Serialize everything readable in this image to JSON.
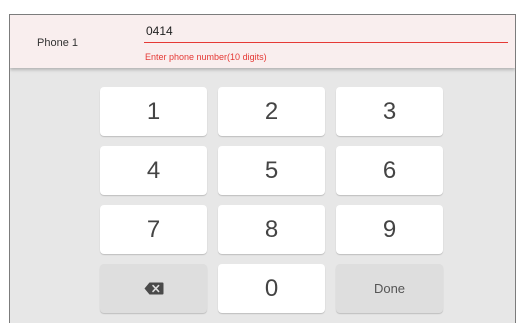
{
  "field": {
    "label": "Phone 1",
    "value": "0414",
    "error": "Enter phone number(10 digits)",
    "error_color": "#e53935"
  },
  "keypad": {
    "keys": [
      "1",
      "2",
      "3",
      "4",
      "5",
      "6",
      "7",
      "8",
      "9",
      "0"
    ],
    "backspace_icon": "backspace-icon",
    "done_label": "Done"
  },
  "colors": {
    "background": "#e7e7e7",
    "key": "#ffffff",
    "function_key": "#dedede",
    "field_background": "#f9eeee"
  }
}
